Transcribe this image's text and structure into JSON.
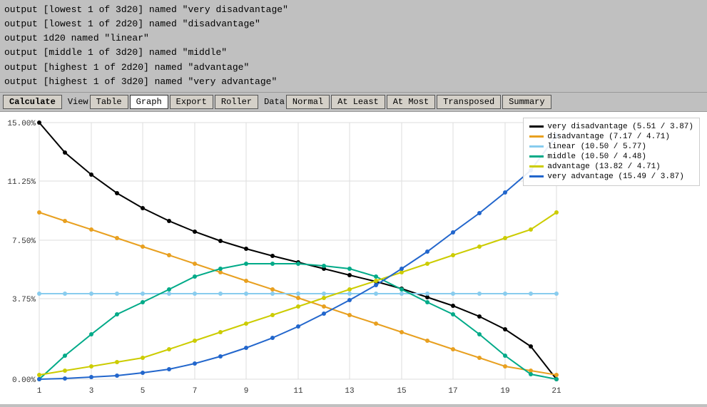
{
  "output": {
    "lines": [
      "output [lowest 1 of 3d20] named \"very disadvantage\"",
      "output [lowest 1 of 2d20] named \"disadvantage\"",
      "output 1d20 named \"linear\"",
      "output [middle 1 of 3d20] named \"middle\"",
      "output [highest 1 of 2d20] named \"advantage\"",
      "output [highest 1 of 3d20] named \"very advantage\""
    ]
  },
  "toolbar": {
    "calculate": "Calculate",
    "view": "View",
    "table": "Table",
    "graph": "Graph",
    "export": "Export",
    "roller": "Roller",
    "data": "Data",
    "normal": "Normal",
    "at_least": "At Least",
    "at_most": "At Most",
    "transposed": "Transposed",
    "summary": "Summary"
  },
  "chart": {
    "y_labels": [
      "15.00%",
      "11.25%",
      "7.50%",
      "3.75%",
      "0.00%"
    ],
    "x_labels": [
      "1",
      "3",
      "5",
      "7",
      "9",
      "11",
      "13",
      "15",
      "17",
      "19",
      "21"
    ]
  },
  "legend": {
    "items": [
      {
        "label": "very disadvantage (5.51 / 3.87)",
        "color": "#000000"
      },
      {
        "label": "disadvantage (7.17 / 4.71)",
        "color": "#e8a020"
      },
      {
        "label": "linear (10.50 / 5.77)",
        "color": "#88ccee"
      },
      {
        "label": "middle (10.50 / 4.48)",
        "color": "#00aa88"
      },
      {
        "label": "advantage (13.82 / 4.71)",
        "color": "#dddd00"
      },
      {
        "label": "very advantage (15.49 / 3.87)",
        "color": "#2266cc"
      }
    ]
  }
}
